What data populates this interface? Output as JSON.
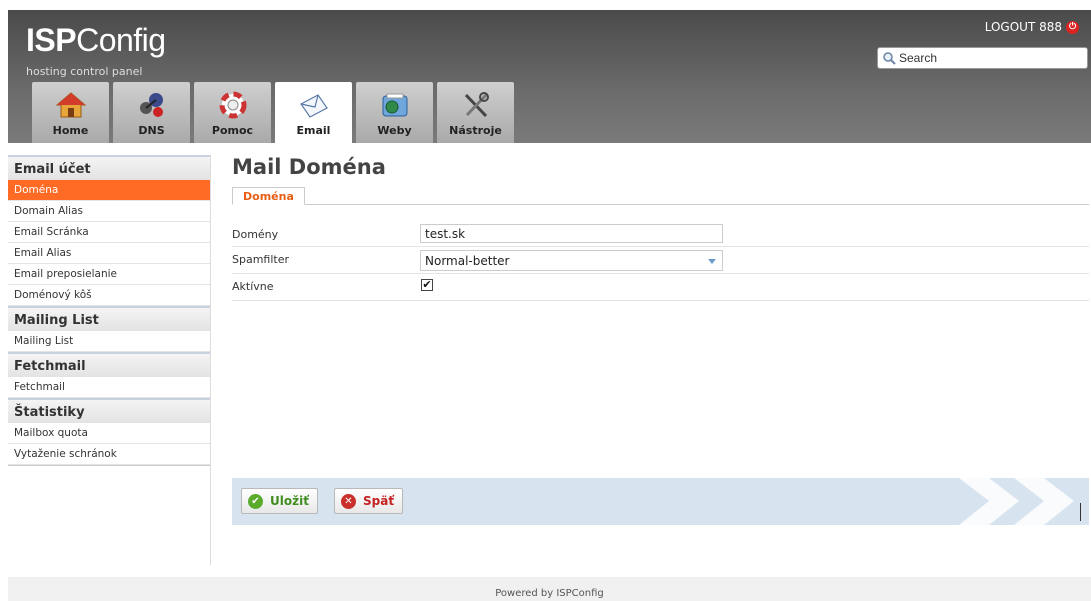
{
  "header": {
    "logo_bold": "ISP",
    "logo_rest": "Config",
    "tagline": "hosting control panel",
    "logout_label": "LOGOUT 888",
    "search_placeholder": "Search"
  },
  "tabs": [
    {
      "label": "Home",
      "icon": "home-icon",
      "active": false
    },
    {
      "label": "DNS",
      "icon": "dns-icon",
      "active": false
    },
    {
      "label": "Pomoc",
      "icon": "help-icon",
      "active": false
    },
    {
      "label": "Email",
      "icon": "envelope-icon",
      "active": true
    },
    {
      "label": "Weby",
      "icon": "websites-icon",
      "active": false
    },
    {
      "label": "Nástroje",
      "icon": "tools-icon",
      "active": false
    }
  ],
  "sidebar": {
    "sections": [
      {
        "title": "Email účet",
        "items": [
          "Doména",
          "Domain Alias",
          "Email Scránka",
          "Email Alias",
          "Email preposielanie",
          "Doménový kôš"
        ]
      },
      {
        "title": "Mailing List",
        "items": [
          "Mailing List"
        ]
      },
      {
        "title": "Fetchmail",
        "items": [
          "Fetchmail"
        ]
      },
      {
        "title": "Štatistiky",
        "items": [
          "Mailbox quota",
          "Vytaženie schránok"
        ]
      }
    ],
    "active_item": "Doména"
  },
  "main": {
    "title": "Mail Doména",
    "subtab": "Doména",
    "fields": {
      "domain_label": "Domény",
      "domain_value": "test.sk",
      "spam_label": "Spamfilter",
      "spam_value": "Normal-better",
      "active_label": "Aktívne",
      "active_checked": true
    },
    "buttons": {
      "save": "Uložiť",
      "back": "Späť"
    }
  },
  "footer": {
    "text": "Powered by ISPConfig"
  },
  "colors": {
    "accent": "#ff6a24",
    "header_dark": "#4a4a4a",
    "button_bar": "#d7e3ef"
  }
}
